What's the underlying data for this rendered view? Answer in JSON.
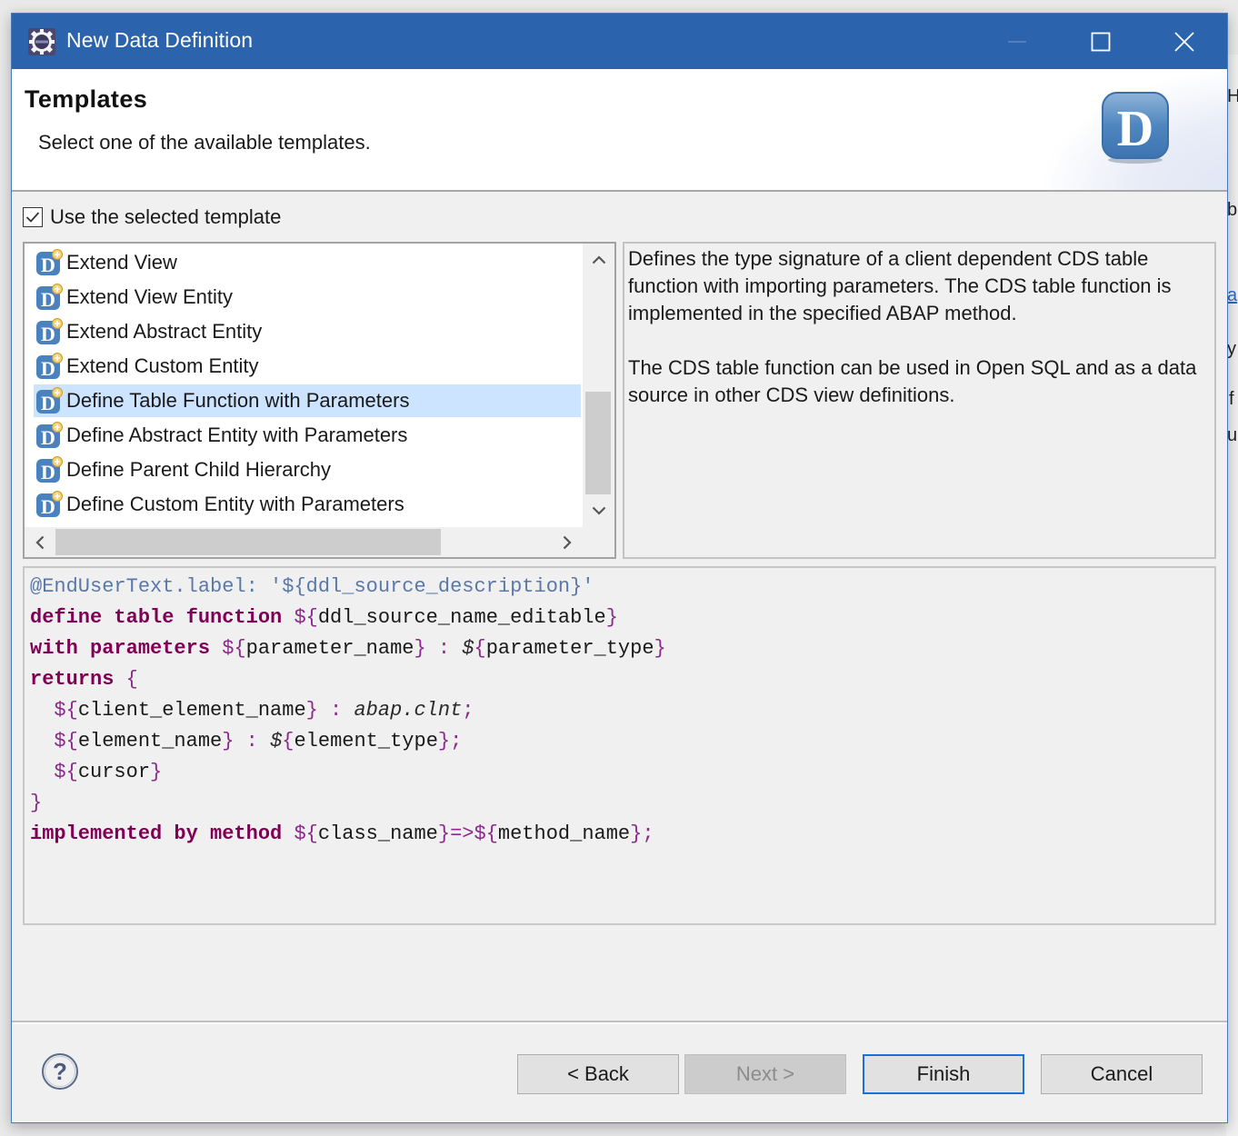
{
  "window": {
    "title": "New Data Definition",
    "app_icon": "eclipse-gear-icon",
    "controls": {
      "minimize": "minimize-icon",
      "maximize": "maximize-icon",
      "close": "close-icon"
    }
  },
  "header": {
    "title": "Templates",
    "subtitle": "Select one of the available templates.",
    "logo": "data-definition-logo-icon",
    "logo_letter": "D"
  },
  "use_template": {
    "label": "Use the selected template",
    "checked": true
  },
  "templates": {
    "items": [
      {
        "label": "Extend View",
        "selected": false
      },
      {
        "label": "Extend View Entity",
        "selected": false
      },
      {
        "label": "Extend Abstract Entity",
        "selected": false
      },
      {
        "label": "Extend Custom Entity",
        "selected": false
      },
      {
        "label": "Define Table Function with Parameters",
        "selected": true
      },
      {
        "label": "Define Abstract Entity with Parameters",
        "selected": false
      },
      {
        "label": "Define Parent Child Hierarchy",
        "selected": false
      },
      {
        "label": "Define Custom Entity with Parameters",
        "selected": false
      }
    ],
    "item_icon": "ddl-template-icon",
    "scroll": {
      "up": "chevron-up-icon",
      "down": "chevron-down-icon",
      "left": "chevron-left-icon",
      "right": "chevron-right-icon"
    }
  },
  "description": {
    "paragraphs": [
      "Defines the type signature of a client dependent CDS table function with importing parameters. The CDS table function is implemented in the specified ABAP method.",
      "The CDS table function can be used in Open SQL and as a data source in other CDS view definitions."
    ]
  },
  "code_preview": {
    "lines": [
      [
        {
          "t": "ann",
          "v": "@EndUserText.label: '${ddl_source_description}'"
        }
      ],
      [
        {
          "t": "kw",
          "v": "define table function "
        },
        {
          "t": "punct",
          "v": "$"
        },
        {
          "t": "brace",
          "v": "{"
        },
        {
          "t": "var",
          "v": "ddl_source_name_editable"
        },
        {
          "t": "brace",
          "v": "}"
        }
      ],
      [
        {
          "t": "kw",
          "v": "with parameters "
        },
        {
          "t": "punct",
          "v": "$"
        },
        {
          "t": "brace",
          "v": "{"
        },
        {
          "t": "var",
          "v": "parameter_name"
        },
        {
          "t": "brace",
          "v": "}"
        },
        {
          "t": "punct",
          "v": " : "
        },
        {
          "t": "type",
          "v": "$"
        },
        {
          "t": "brace",
          "v": "{"
        },
        {
          "t": "var",
          "v": "parameter_type"
        },
        {
          "t": "brace",
          "v": "}"
        }
      ],
      [
        {
          "t": "kw",
          "v": "returns "
        },
        {
          "t": "brace",
          "v": "{"
        }
      ],
      [
        {
          "t": "var",
          "v": "  "
        },
        {
          "t": "punct",
          "v": "$"
        },
        {
          "t": "brace",
          "v": "{"
        },
        {
          "t": "var",
          "v": "client_element_name"
        },
        {
          "t": "brace",
          "v": "}"
        },
        {
          "t": "punct",
          "v": " : "
        },
        {
          "t": "type",
          "v": "abap.clnt"
        },
        {
          "t": "punct",
          "v": ";"
        }
      ],
      [
        {
          "t": "var",
          "v": "  "
        },
        {
          "t": "punct",
          "v": "$"
        },
        {
          "t": "brace",
          "v": "{"
        },
        {
          "t": "var",
          "v": "element_name"
        },
        {
          "t": "brace",
          "v": "}"
        },
        {
          "t": "punct",
          "v": " : "
        },
        {
          "t": "type",
          "v": "$"
        },
        {
          "t": "brace",
          "v": "{"
        },
        {
          "t": "var",
          "v": "element_type"
        },
        {
          "t": "brace",
          "v": "}"
        },
        {
          "t": "punct",
          "v": ";"
        }
      ],
      [
        {
          "t": "var",
          "v": "  "
        },
        {
          "t": "punct",
          "v": "$"
        },
        {
          "t": "brace",
          "v": "{"
        },
        {
          "t": "var",
          "v": "cursor"
        },
        {
          "t": "brace",
          "v": "}"
        }
      ],
      [
        {
          "t": "brace",
          "v": "}"
        }
      ],
      [
        {
          "t": "kw",
          "v": "implemented by method "
        },
        {
          "t": "punct",
          "v": "$"
        },
        {
          "t": "brace",
          "v": "{"
        },
        {
          "t": "var",
          "v": "class_name"
        },
        {
          "t": "brace",
          "v": "}"
        },
        {
          "t": "punct",
          "v": "=>$"
        },
        {
          "t": "brace",
          "v": "{"
        },
        {
          "t": "var",
          "v": "method_name"
        },
        {
          "t": "brace",
          "v": "}"
        },
        {
          "t": "punct",
          "v": ";"
        }
      ]
    ]
  },
  "footer": {
    "help_icon": "help-icon",
    "buttons": {
      "back": "< Back",
      "next": "Next >",
      "finish": "Finish",
      "cancel": "Cancel"
    },
    "next_enabled": false,
    "default_button": "finish"
  },
  "colors": {
    "titlebar": "#2b63ad",
    "selection": "#cce4ff",
    "keyword": "#7f0055",
    "annotation": "#5a78a8",
    "default_button_border": "#1e6fd6"
  }
}
